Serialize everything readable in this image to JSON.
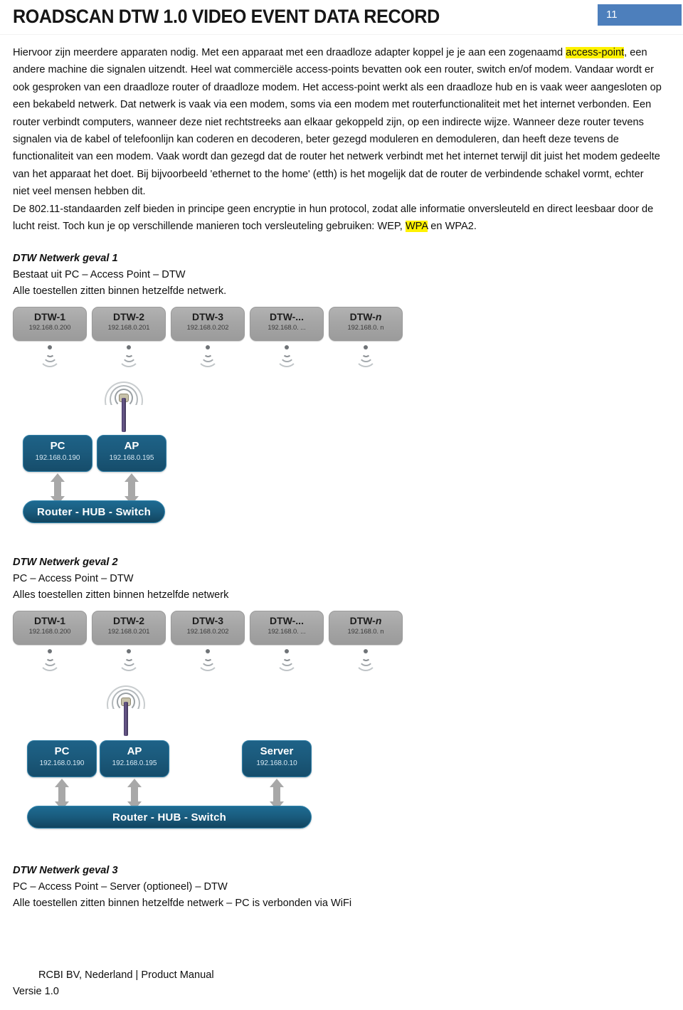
{
  "header": {
    "title": "ROADSCAN DTW 1.0 VIDEO EVENT DATA RECORD",
    "page_number": "11",
    "badge_color": "#4d7fbc"
  },
  "body": {
    "paragraph_1_a": "Hiervoor zijn meerdere apparaten nodig. Met een apparaat met een draadloze adapter koppel je je aan een zogenaamd ",
    "highlight_1": "access-point",
    "paragraph_1_b": ", een andere machine die signalen uitzendt. Heel wat commerciële access-points bevatten ook een router, switch en/of modem. Vandaar wordt er ook gesproken van een draadloze router of draadloze modem. Het access-point werkt als een draadloze hub en is vaak weer aangesloten op een bekabeld netwerk. Dat netwerk is vaak via een modem, soms via een modem met routerfunctionaliteit met het internet verbonden. Een router verbindt computers, wanneer deze niet rechtstreeks aan elkaar gekoppeld zijn, op een indirecte wijze. Wanneer deze router tevens signalen via de kabel of telefoonlijn kan coderen en decoderen, beter gezegd moduleren en demoduleren, dan heeft deze tevens de functionaliteit van een modem. Vaak wordt dan gezegd dat de router het netwerk verbindt met het internet terwijl dit juist het modem gedeelte van het apparaat het doet. Bij bijvoorbeeld 'ethernet to the home' (etth) is het mogelijk dat de router de verbindende schakel vormt, echter niet veel mensen hebben dit.",
    "paragraph_2_a": "De 802.11-standaarden zelf bieden in principe geen encryptie in hun protocol, zodat alle informatie onversleuteld en direct leesbaar door de lucht reist. Toch kun je op verschillende manieren toch versleuteling gebruiken: WEP, ",
    "highlight_2": "WPA",
    "paragraph_2_b": " en WPA2.",
    "highlight_color": "#fff200"
  },
  "sections": [
    {
      "title": "DTW Netwerk geval 1",
      "line_1": "Bestaat uit PC – Access Point – DTW",
      "line_2": "Alle toestellen zitten binnen hetzelfde netwerk."
    },
    {
      "title": "DTW Netwerk geval 2",
      "line_1": "PC – Access Point – DTW",
      "line_2": "Alles toestellen zitten binnen hetzelfde netwerk"
    },
    {
      "title": "DTW Netwerk geval 3",
      "line_1": "PC – Access Point – Server (optioneel) – DTW",
      "line_2": "Alle toestellen zitten binnen hetzelfde netwerk – PC is verbonden via WiFi"
    }
  ],
  "diagram_1": {
    "dtw_devices": [
      {
        "name": "DTW-1",
        "name_suffix": "",
        "ip": "192.168.0.200"
      },
      {
        "name": "DTW-2",
        "name_suffix": "",
        "ip": "192.168.0.201"
      },
      {
        "name": "DTW-3",
        "name_suffix": "",
        "ip": "192.168.0.202"
      },
      {
        "name": "DTW-...",
        "name_suffix": "",
        "ip": "192.168.0. ..."
      },
      {
        "name": "DTW-",
        "name_suffix": "n",
        "ip": "192.168.0. n"
      }
    ],
    "nodes": [
      {
        "name": "PC",
        "ip": "192.168.0.190"
      },
      {
        "name": "AP",
        "ip": "192.168.0.195"
      }
    ],
    "router_label": "Router - HUB - Switch",
    "node_color": "#1b5a7c",
    "dtw_color": "#a5a5a5"
  },
  "diagram_2": {
    "dtw_devices": [
      {
        "name": "DTW-1",
        "name_suffix": "",
        "ip": "192.168.0.200"
      },
      {
        "name": "DTW-2",
        "name_suffix": "",
        "ip": "192.168.0.201"
      },
      {
        "name": "DTW-3",
        "name_suffix": "",
        "ip": "192.168.0.202"
      },
      {
        "name": "DTW-...",
        "name_suffix": "",
        "ip": "192.168.0. ..."
      },
      {
        "name": "DTW-",
        "name_suffix": "n",
        "ip": "192.168.0. n"
      }
    ],
    "nodes": [
      {
        "name": "PC",
        "ip": "192.168.0.190"
      },
      {
        "name": "AP",
        "ip": "192.168.0.195"
      },
      {
        "name": "Server",
        "ip": "192.168.0.10"
      }
    ],
    "router_label": "Router - HUB - Switch",
    "node_color": "#1b5a7c",
    "dtw_color": "#a5a5a5"
  },
  "footer": {
    "line_1": "RCBI BV, Nederland | Product Manual",
    "line_2": "Versie 1.0"
  }
}
